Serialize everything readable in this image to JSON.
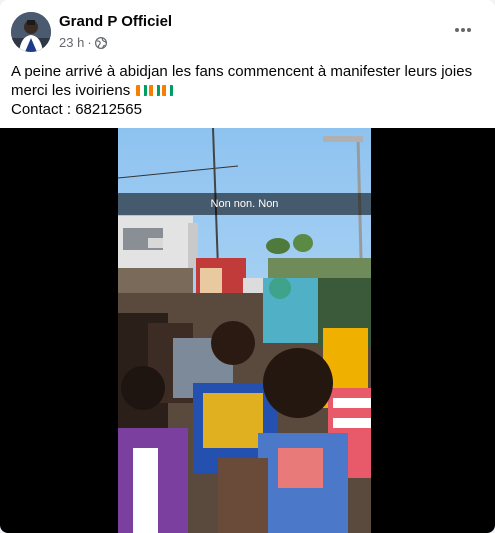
{
  "post": {
    "author": "Grand P Officiel",
    "time": "23 h",
    "separator": "·",
    "privacy_icon": "globe-icon",
    "more_icon": "more-horizontal-icon",
    "text_line1": "A peine arrivé à abidjan les fans commencent à manifester leurs joies",
    "text_line2": "merci les ivoiriens",
    "text_line3": "Contact : 68212565",
    "flag_count": 3,
    "flag_colors": [
      "#f77f00",
      "#ffffff",
      "#009e60"
    ]
  },
  "video": {
    "caption": "Non non. Non"
  }
}
